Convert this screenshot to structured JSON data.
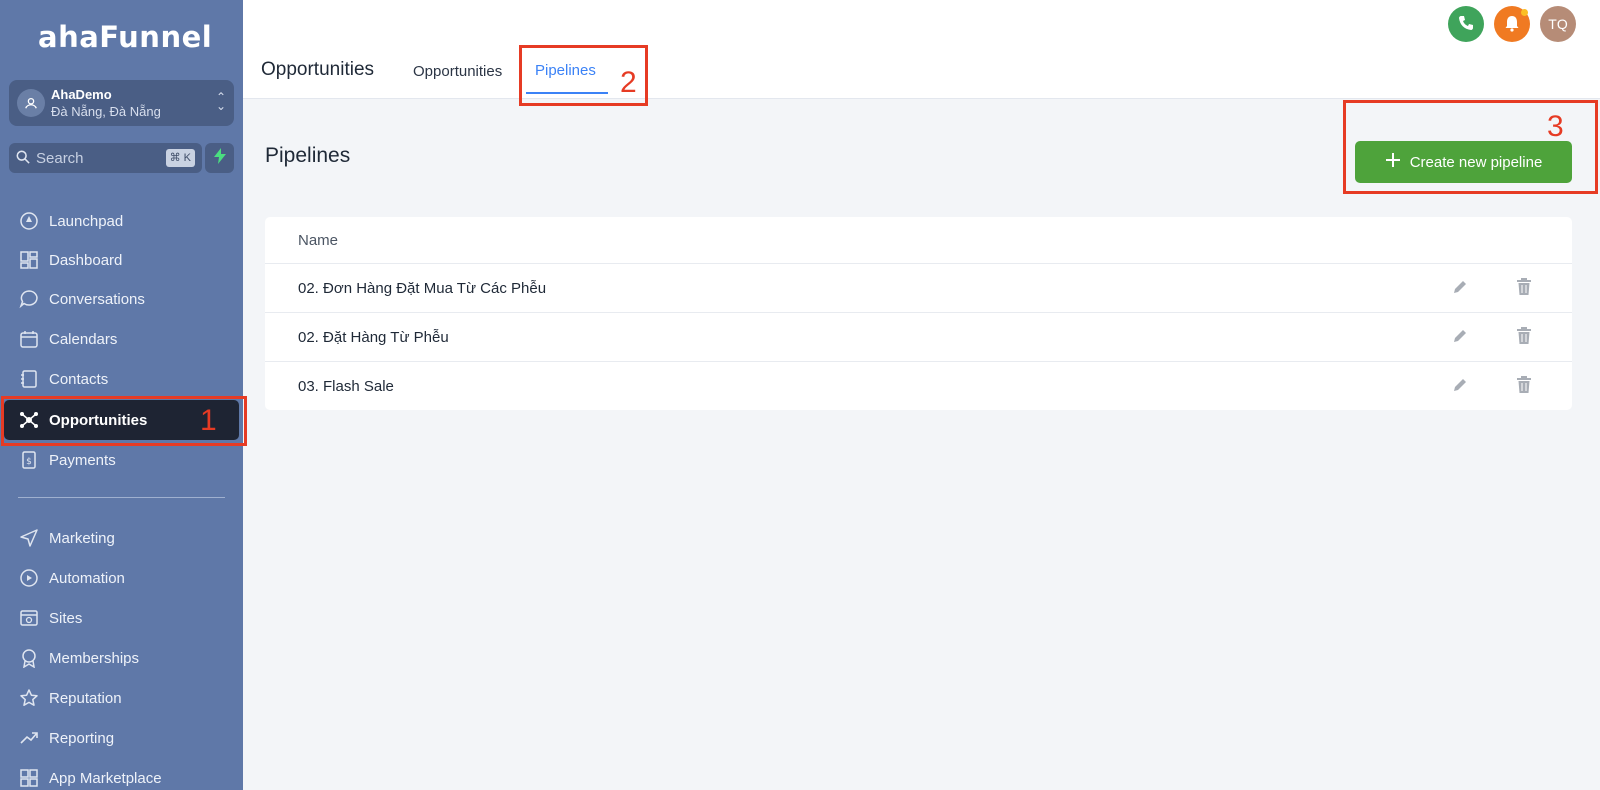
{
  "app": {
    "logo": "ahaFunnel"
  },
  "account": {
    "name": "AhaDemo",
    "location": "Đà Nẵng, Đà Nẵng"
  },
  "search": {
    "placeholder": "Search",
    "shortcut": "⌘ K"
  },
  "sidebar": {
    "items": [
      {
        "label": "Launchpad",
        "icon": "launchpad-icon"
      },
      {
        "label": "Dashboard",
        "icon": "dashboard-icon"
      },
      {
        "label": "Conversations",
        "icon": "chat-icon"
      },
      {
        "label": "Calendars",
        "icon": "calendar-icon"
      },
      {
        "label": "Contacts",
        "icon": "contacts-icon"
      },
      {
        "label": "Opportunities",
        "icon": "opportunities-icon",
        "active": true
      },
      {
        "label": "Payments",
        "icon": "payments-icon"
      },
      {
        "label": "Marketing",
        "icon": "send-icon"
      },
      {
        "label": "Automation",
        "icon": "automation-icon"
      },
      {
        "label": "Sites",
        "icon": "sites-icon"
      },
      {
        "label": "Memberships",
        "icon": "badge-icon"
      },
      {
        "label": "Reputation",
        "icon": "star-icon"
      },
      {
        "label": "Reporting",
        "icon": "trend-icon"
      },
      {
        "label": "App Marketplace",
        "icon": "grid-icon"
      }
    ]
  },
  "header": {
    "title": "Opportunities",
    "tabs": [
      {
        "label": "Opportunities"
      },
      {
        "label": "Pipelines",
        "active": true
      }
    ],
    "avatar_initials": "TQ",
    "colors": {
      "phone": "#3fa45b",
      "bell": "#f07a22",
      "avatar": "#b68c77"
    }
  },
  "main": {
    "section_title": "Pipelines",
    "create_button": "Create new pipeline",
    "table": {
      "column": "Name",
      "rows": [
        {
          "name": "02. Đơn Hàng Đặt Mua Từ Các Phễu"
        },
        {
          "name": "02. Đặt Hàng Từ Phễu"
        },
        {
          "name": "03. Flash Sale"
        }
      ]
    }
  },
  "annotations": {
    "one": "1",
    "two": "2",
    "three": "3",
    "color": "#e63b24"
  }
}
